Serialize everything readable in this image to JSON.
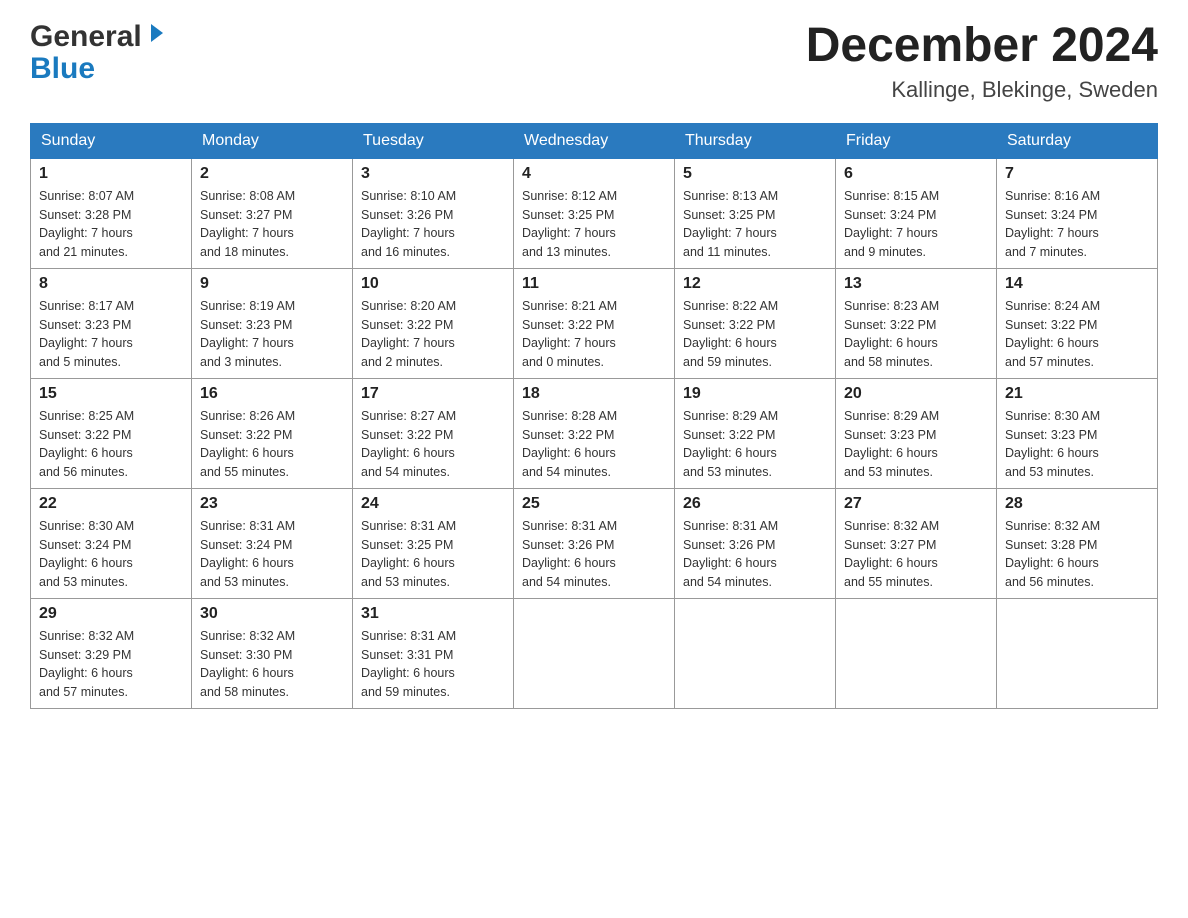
{
  "header": {
    "logo_general": "General",
    "logo_blue": "Blue",
    "month_title": "December 2024",
    "location": "Kallinge, Blekinge, Sweden"
  },
  "columns": [
    "Sunday",
    "Monday",
    "Tuesday",
    "Wednesday",
    "Thursday",
    "Friday",
    "Saturday"
  ],
  "weeks": [
    [
      {
        "day": "1",
        "sunrise": "Sunrise: 8:07 AM",
        "sunset": "Sunset: 3:28 PM",
        "daylight": "Daylight: 7 hours",
        "daylight2": "and 21 minutes."
      },
      {
        "day": "2",
        "sunrise": "Sunrise: 8:08 AM",
        "sunset": "Sunset: 3:27 PM",
        "daylight": "Daylight: 7 hours",
        "daylight2": "and 18 minutes."
      },
      {
        "day": "3",
        "sunrise": "Sunrise: 8:10 AM",
        "sunset": "Sunset: 3:26 PM",
        "daylight": "Daylight: 7 hours",
        "daylight2": "and 16 minutes."
      },
      {
        "day": "4",
        "sunrise": "Sunrise: 8:12 AM",
        "sunset": "Sunset: 3:25 PM",
        "daylight": "Daylight: 7 hours",
        "daylight2": "and 13 minutes."
      },
      {
        "day": "5",
        "sunrise": "Sunrise: 8:13 AM",
        "sunset": "Sunset: 3:25 PM",
        "daylight": "Daylight: 7 hours",
        "daylight2": "and 11 minutes."
      },
      {
        "day": "6",
        "sunrise": "Sunrise: 8:15 AM",
        "sunset": "Sunset: 3:24 PM",
        "daylight": "Daylight: 7 hours",
        "daylight2": "and 9 minutes."
      },
      {
        "day": "7",
        "sunrise": "Sunrise: 8:16 AM",
        "sunset": "Sunset: 3:24 PM",
        "daylight": "Daylight: 7 hours",
        "daylight2": "and 7 minutes."
      }
    ],
    [
      {
        "day": "8",
        "sunrise": "Sunrise: 8:17 AM",
        "sunset": "Sunset: 3:23 PM",
        "daylight": "Daylight: 7 hours",
        "daylight2": "and 5 minutes."
      },
      {
        "day": "9",
        "sunrise": "Sunrise: 8:19 AM",
        "sunset": "Sunset: 3:23 PM",
        "daylight": "Daylight: 7 hours",
        "daylight2": "and 3 minutes."
      },
      {
        "day": "10",
        "sunrise": "Sunrise: 8:20 AM",
        "sunset": "Sunset: 3:22 PM",
        "daylight": "Daylight: 7 hours",
        "daylight2": "and 2 minutes."
      },
      {
        "day": "11",
        "sunrise": "Sunrise: 8:21 AM",
        "sunset": "Sunset: 3:22 PM",
        "daylight": "Daylight: 7 hours",
        "daylight2": "and 0 minutes."
      },
      {
        "day": "12",
        "sunrise": "Sunrise: 8:22 AM",
        "sunset": "Sunset: 3:22 PM",
        "daylight": "Daylight: 6 hours",
        "daylight2": "and 59 minutes."
      },
      {
        "day": "13",
        "sunrise": "Sunrise: 8:23 AM",
        "sunset": "Sunset: 3:22 PM",
        "daylight": "Daylight: 6 hours",
        "daylight2": "and 58 minutes."
      },
      {
        "day": "14",
        "sunrise": "Sunrise: 8:24 AM",
        "sunset": "Sunset: 3:22 PM",
        "daylight": "Daylight: 6 hours",
        "daylight2": "and 57 minutes."
      }
    ],
    [
      {
        "day": "15",
        "sunrise": "Sunrise: 8:25 AM",
        "sunset": "Sunset: 3:22 PM",
        "daylight": "Daylight: 6 hours",
        "daylight2": "and 56 minutes."
      },
      {
        "day": "16",
        "sunrise": "Sunrise: 8:26 AM",
        "sunset": "Sunset: 3:22 PM",
        "daylight": "Daylight: 6 hours",
        "daylight2": "and 55 minutes."
      },
      {
        "day": "17",
        "sunrise": "Sunrise: 8:27 AM",
        "sunset": "Sunset: 3:22 PM",
        "daylight": "Daylight: 6 hours",
        "daylight2": "and 54 minutes."
      },
      {
        "day": "18",
        "sunrise": "Sunrise: 8:28 AM",
        "sunset": "Sunset: 3:22 PM",
        "daylight": "Daylight: 6 hours",
        "daylight2": "and 54 minutes."
      },
      {
        "day": "19",
        "sunrise": "Sunrise: 8:29 AM",
        "sunset": "Sunset: 3:22 PM",
        "daylight": "Daylight: 6 hours",
        "daylight2": "and 53 minutes."
      },
      {
        "day": "20",
        "sunrise": "Sunrise: 8:29 AM",
        "sunset": "Sunset: 3:23 PM",
        "daylight": "Daylight: 6 hours",
        "daylight2": "and 53 minutes."
      },
      {
        "day": "21",
        "sunrise": "Sunrise: 8:30 AM",
        "sunset": "Sunset: 3:23 PM",
        "daylight": "Daylight: 6 hours",
        "daylight2": "and 53 minutes."
      }
    ],
    [
      {
        "day": "22",
        "sunrise": "Sunrise: 8:30 AM",
        "sunset": "Sunset: 3:24 PM",
        "daylight": "Daylight: 6 hours",
        "daylight2": "and 53 minutes."
      },
      {
        "day": "23",
        "sunrise": "Sunrise: 8:31 AM",
        "sunset": "Sunset: 3:24 PM",
        "daylight": "Daylight: 6 hours",
        "daylight2": "and 53 minutes."
      },
      {
        "day": "24",
        "sunrise": "Sunrise: 8:31 AM",
        "sunset": "Sunset: 3:25 PM",
        "daylight": "Daylight: 6 hours",
        "daylight2": "and 53 minutes."
      },
      {
        "day": "25",
        "sunrise": "Sunrise: 8:31 AM",
        "sunset": "Sunset: 3:26 PM",
        "daylight": "Daylight: 6 hours",
        "daylight2": "and 54 minutes."
      },
      {
        "day": "26",
        "sunrise": "Sunrise: 8:31 AM",
        "sunset": "Sunset: 3:26 PM",
        "daylight": "Daylight: 6 hours",
        "daylight2": "and 54 minutes."
      },
      {
        "day": "27",
        "sunrise": "Sunrise: 8:32 AM",
        "sunset": "Sunset: 3:27 PM",
        "daylight": "Daylight: 6 hours",
        "daylight2": "and 55 minutes."
      },
      {
        "day": "28",
        "sunrise": "Sunrise: 8:32 AM",
        "sunset": "Sunset: 3:28 PM",
        "daylight": "Daylight: 6 hours",
        "daylight2": "and 56 minutes."
      }
    ],
    [
      {
        "day": "29",
        "sunrise": "Sunrise: 8:32 AM",
        "sunset": "Sunset: 3:29 PM",
        "daylight": "Daylight: 6 hours",
        "daylight2": "and 57 minutes."
      },
      {
        "day": "30",
        "sunrise": "Sunrise: 8:32 AM",
        "sunset": "Sunset: 3:30 PM",
        "daylight": "Daylight: 6 hours",
        "daylight2": "and 58 minutes."
      },
      {
        "day": "31",
        "sunrise": "Sunrise: 8:31 AM",
        "sunset": "Sunset: 3:31 PM",
        "daylight": "Daylight: 6 hours",
        "daylight2": "and 59 minutes."
      },
      null,
      null,
      null,
      null
    ]
  ]
}
